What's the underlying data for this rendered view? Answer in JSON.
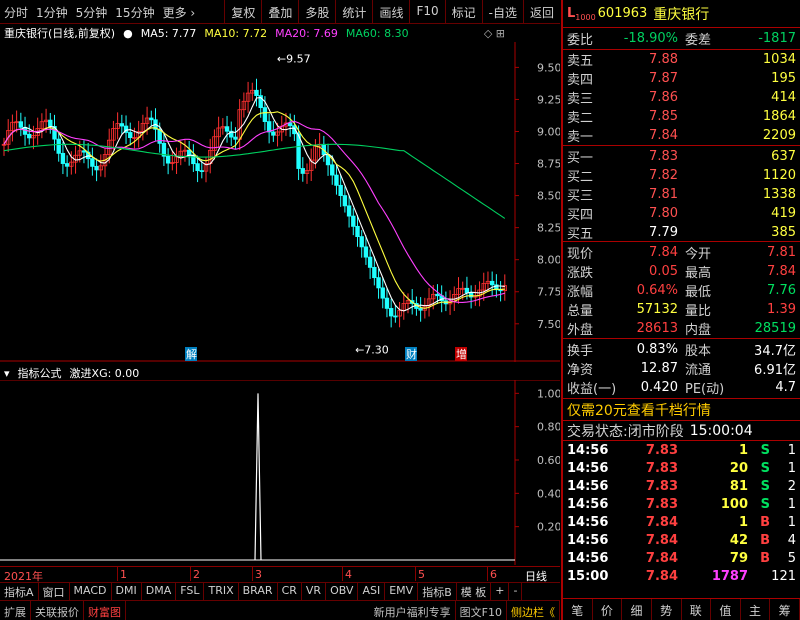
{
  "toolbar": {
    "left": [
      "分时",
      "1分钟",
      "5分钟",
      "15分钟",
      "更多 ›"
    ],
    "right": [
      "复权",
      "叠加",
      "多股",
      "统计",
      "画线",
      "F10",
      "标记",
      "-自选",
      "返回"
    ]
  },
  "chart_header": {
    "title": "重庆银行(日线,前复权)",
    "ma5": "MA5: 7.77",
    "ma10": "MA10: 7.72",
    "ma20": "MA20: 7.69",
    "ma60": "MA60: 8.30"
  },
  "annotations": {
    "high": "9.57",
    "low": "7.30",
    "marker_jie": "解",
    "marker_cai": "财",
    "marker_zeng": "增"
  },
  "indicator_header": {
    "name": "指标公式",
    "value": "激进XG: 0.00"
  },
  "x_axis": {
    "year": "2021年",
    "labels": [
      "1",
      "2",
      "3",
      "4",
      "5",
      "6"
    ],
    "period": "日线"
  },
  "tabs": [
    "指标A",
    "窗口",
    "MACD",
    "DMI",
    "DMA",
    "FSL",
    "TRIX",
    "BRAR",
    "CR",
    "VR",
    "OBV",
    "ASI",
    "EMV",
    "指标B",
    "模 板",
    "+",
    "-"
  ],
  "bottom_bar": [
    "扩展",
    "关联报价",
    "财富图",
    "新用户福利专享",
    "图文F10",
    "侧边栏《"
  ],
  "chart_data": {
    "type": "candlestick",
    "price_axis": {
      "ticks": [
        9.5,
        9.25,
        9.0,
        8.75,
        8.5,
        8.25,
        8.0,
        7.75,
        7.5
      ],
      "range": [
        7.28,
        9.62
      ]
    },
    "indicator_axis": {
      "ticks": [
        1.0,
        0.8,
        0.6,
        0.4,
        0.2
      ],
      "range": [
        0,
        1.05
      ]
    },
    "ma_last": {
      "ma5": 7.77,
      "ma10": 7.72,
      "ma20": 7.69,
      "ma60": 8.3
    },
    "signal": {
      "x_label": "3",
      "value": 1.0
    }
  },
  "quote": {
    "code_prefix": "L",
    "code_sub": "1000",
    "code": "601963",
    "name": "重庆银行",
    "webi_label": "委比",
    "webi": "-18.90%",
    "weicha_label": "委差",
    "weicha": "-1817",
    "asks": [
      {
        "label": "卖五",
        "price": "7.88",
        "vol": "1034"
      },
      {
        "label": "卖四",
        "price": "7.87",
        "vol": "195"
      },
      {
        "label": "卖三",
        "price": "7.86",
        "vol": "414"
      },
      {
        "label": "卖二",
        "price": "7.85",
        "vol": "1864"
      },
      {
        "label": "卖一",
        "price": "7.84",
        "vol": "2209"
      }
    ],
    "bids": [
      {
        "label": "买一",
        "price": "7.83",
        "vol": "637"
      },
      {
        "label": "买二",
        "price": "7.82",
        "vol": "1120"
      },
      {
        "label": "买三",
        "price": "7.81",
        "vol": "1338"
      },
      {
        "label": "买四",
        "price": "7.80",
        "vol": "419"
      },
      {
        "label": "买五",
        "price": "7.79",
        "vol": "385"
      }
    ],
    "stats": [
      {
        "l1": "现价",
        "v1": "7.84",
        "l2": "今开",
        "v2": "7.81",
        "c1": "red",
        "c2": "red"
      },
      {
        "l1": "涨跌",
        "v1": "0.05",
        "l2": "最高",
        "v2": "7.84",
        "c1": "red",
        "c2": "red"
      },
      {
        "l1": "涨幅",
        "v1": "0.64%",
        "l2": "最低",
        "v2": "7.76",
        "c1": "red",
        "c2": "green"
      },
      {
        "l1": "总量",
        "v1": "57132",
        "l2": "量比",
        "v2": "1.39",
        "c1": "yellow",
        "c2": "red"
      },
      {
        "l1": "外盘",
        "v1": "28613",
        "l2": "内盘",
        "v2": "28519",
        "c1": "red",
        "c2": "green"
      }
    ],
    "stats2": [
      {
        "l1": "换手",
        "v1": "0.83%",
        "l2": "股本",
        "v2": "34.7亿"
      },
      {
        "l1": "净资",
        "v1": "12.87",
        "l2": "流通",
        "v2": "6.91亿"
      },
      {
        "l1": "收益(一)",
        "v1": "0.420",
        "l2": "PE(动)",
        "v2": "4.7"
      }
    ],
    "promo": "仅需20元查看千档行情",
    "status_label": "交易状态:",
    "status": "闭市阶段",
    "status_time": "15:00:04",
    "ticks": [
      {
        "t": "14:56",
        "p": "7.83",
        "v": "1",
        "s": "S",
        "n": "1",
        "pc": "red",
        "sc": "green"
      },
      {
        "t": "14:56",
        "p": "7.83",
        "v": "20",
        "s": "S",
        "n": "1",
        "pc": "red",
        "sc": "green"
      },
      {
        "t": "14:56",
        "p": "7.83",
        "v": "81",
        "s": "S",
        "n": "2",
        "pc": "red",
        "sc": "green"
      },
      {
        "t": "14:56",
        "p": "7.83",
        "v": "100",
        "s": "S",
        "n": "1",
        "pc": "red",
        "sc": "green"
      },
      {
        "t": "14:56",
        "p": "7.84",
        "v": "1",
        "s": "B",
        "n": "1",
        "pc": "red",
        "sc": "red"
      },
      {
        "t": "14:56",
        "p": "7.84",
        "v": "42",
        "s": "B",
        "n": "4",
        "pc": "red",
        "sc": "red"
      },
      {
        "t": "14:56",
        "p": "7.84",
        "v": "79",
        "s": "B",
        "n": "5",
        "pc": "red",
        "sc": "red"
      },
      {
        "t": "15:00",
        "p": "7.84",
        "v": "1787",
        "s": "",
        "n": "121",
        "pc": "red",
        "sc": "red"
      }
    ],
    "bottom_tabs": [
      "笔",
      "价",
      "细",
      "势",
      "联",
      "值",
      "主",
      "筹"
    ]
  }
}
